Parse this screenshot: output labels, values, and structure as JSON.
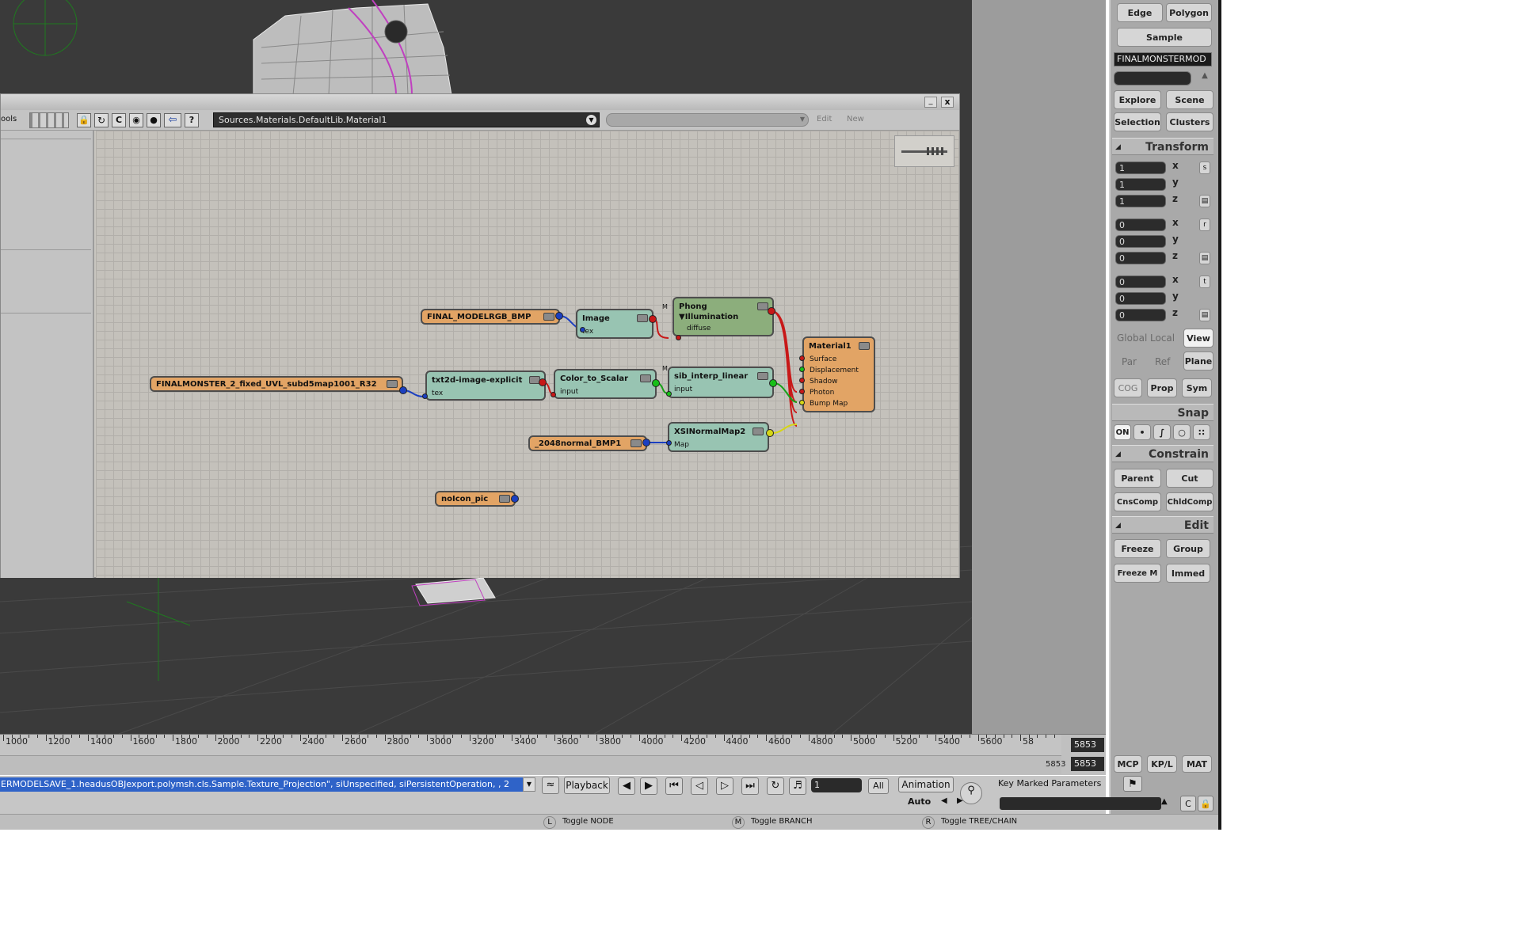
{
  "render_tree": {
    "title": "",
    "path": "Sources.Materials.DefaultLib.Material1",
    "tools_label": "ools",
    "edit_label": "Edit",
    "new_label": "New",
    "minimize": "_",
    "close": "x",
    "nodes": {
      "final_model": {
        "title": "FINAL_MODELRGB_BMP"
      },
      "image": {
        "title": "Image",
        "port": "tex"
      },
      "phong": {
        "title": "Phong",
        "group": "▼Illumination",
        "port": "diffuse"
      },
      "finalmonster": {
        "title": "FINALMONSTER_2_fixed_UVL_subd5map1001_R32"
      },
      "txt2d": {
        "title": "txt2d-image-explicit",
        "port": "tex"
      },
      "color_scalar": {
        "title": "Color_to_Scalar",
        "port": "input"
      },
      "sib_interp": {
        "title": "sib_interp_linear",
        "port": "input"
      },
      "material1": {
        "title": "Material1",
        "ports": [
          "Surface",
          "Displacement",
          "Shadow",
          "Photon",
          "Bump Map"
        ]
      },
      "normal_bmp": {
        "title": "_2048normal_BMP1"
      },
      "xsi_normal": {
        "title": "XSINormalMap2",
        "port": "Map"
      },
      "noicon": {
        "title": "noIcon_pic"
      }
    },
    "m_marker": "M",
    "m_marker2": "M"
  },
  "panel": {
    "edge": "Edge",
    "polygon": "Polygon",
    "sample": "Sample",
    "object_name": "FINALMONSTERMOD",
    "explore": "Explore",
    "scene": "Scene",
    "selection": "Selection",
    "clusters": "Clusters",
    "transform": "Transform",
    "scale": [
      "1",
      "1",
      "1"
    ],
    "rotate": [
      "0",
      "0",
      "0"
    ],
    "translate": [
      "0",
      "0",
      "0"
    ],
    "axes": [
      "x",
      "y",
      "z"
    ],
    "s_label": "s",
    "r_label": "r",
    "t_label": "t",
    "global": "Global",
    "local": "Local",
    "view": "View",
    "par": "Par",
    "ref": "Ref",
    "plane": "Plane",
    "cog": "COG",
    "prop": "Prop",
    "sym": "Sym",
    "snap": "Snap",
    "snap_on": "ON",
    "constrain": "Constrain",
    "parent": "Parent",
    "cut": "Cut",
    "cnscomp": "CnsComp",
    "chldcomp": "ChldComp",
    "edit": "Edit",
    "freeze": "Freeze",
    "group": "Group",
    "freeze_m": "Freeze M",
    "immed": "Immed",
    "mcp": "MCP",
    "kpl": "KP/L",
    "mat": "MAT"
  },
  "timeline": {
    "ticks": [
      "1000",
      "1200",
      "1400",
      "1600",
      "1800",
      "2000",
      "2200",
      "2400",
      "2600",
      "2800",
      "3000",
      "3200",
      "3400",
      "3600",
      "3800",
      "4000",
      "4200",
      "4400",
      "4600",
      "4800",
      "5000",
      "5200",
      "5400",
      "5600",
      "58"
    ],
    "end_frame": "5853",
    "end_frame2": "5853",
    "start_small": "5853"
  },
  "command": {
    "script": "ERMODELSAVE_1.headusOBJexport.polymsh.cls.Sample.Texture_Projection\", siUnspecified, siPersistentOperation, , 2",
    "playback": "Playback",
    "frame": "1",
    "all": "All",
    "animation": "Animation",
    "auto": "Auto",
    "key_marked": "Key Marked Parameters"
  },
  "status": {
    "l_key": "L",
    "l_text": "Toggle NODE",
    "m_key": "M",
    "m_text": "Toggle BRANCH",
    "r_key": "R",
    "r_text": "Toggle TREE/CHAIN"
  }
}
